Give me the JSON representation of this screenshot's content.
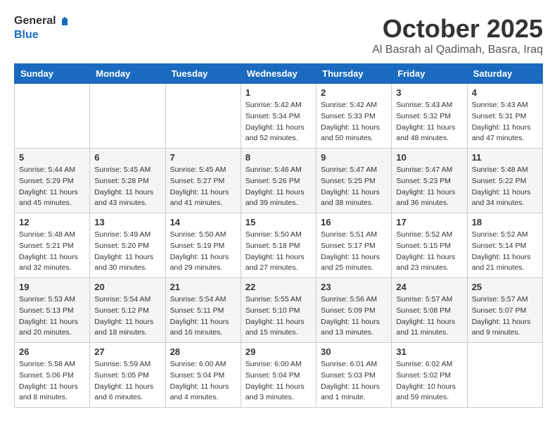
{
  "header": {
    "logo_general": "General",
    "logo_blue": "Blue",
    "month": "October 2025",
    "location": "Al Basrah al Qadimah, Basra, Iraq"
  },
  "weekdays": [
    "Sunday",
    "Monday",
    "Tuesday",
    "Wednesday",
    "Thursday",
    "Friday",
    "Saturday"
  ],
  "weeks": [
    [
      {
        "day": "",
        "sunrise": "",
        "sunset": "",
        "daylight": ""
      },
      {
        "day": "",
        "sunrise": "",
        "sunset": "",
        "daylight": ""
      },
      {
        "day": "",
        "sunrise": "",
        "sunset": "",
        "daylight": ""
      },
      {
        "day": "1",
        "sunrise": "Sunrise: 5:42 AM",
        "sunset": "Sunset: 5:34 PM",
        "daylight": "Daylight: 11 hours and 52 minutes."
      },
      {
        "day": "2",
        "sunrise": "Sunrise: 5:42 AM",
        "sunset": "Sunset: 5:33 PM",
        "daylight": "Daylight: 11 hours and 50 minutes."
      },
      {
        "day": "3",
        "sunrise": "Sunrise: 5:43 AM",
        "sunset": "Sunset: 5:32 PM",
        "daylight": "Daylight: 11 hours and 48 minutes."
      },
      {
        "day": "4",
        "sunrise": "Sunrise: 5:43 AM",
        "sunset": "Sunset: 5:31 PM",
        "daylight": "Daylight: 11 hours and 47 minutes."
      }
    ],
    [
      {
        "day": "5",
        "sunrise": "Sunrise: 5:44 AM",
        "sunset": "Sunset: 5:29 PM",
        "daylight": "Daylight: 11 hours and 45 minutes."
      },
      {
        "day": "6",
        "sunrise": "Sunrise: 5:45 AM",
        "sunset": "Sunset: 5:28 PM",
        "daylight": "Daylight: 11 hours and 43 minutes."
      },
      {
        "day": "7",
        "sunrise": "Sunrise: 5:45 AM",
        "sunset": "Sunset: 5:27 PM",
        "daylight": "Daylight: 11 hours and 41 minutes."
      },
      {
        "day": "8",
        "sunrise": "Sunrise: 5:46 AM",
        "sunset": "Sunset: 5:26 PM",
        "daylight": "Daylight: 11 hours and 39 minutes."
      },
      {
        "day": "9",
        "sunrise": "Sunrise: 5:47 AM",
        "sunset": "Sunset: 5:25 PM",
        "daylight": "Daylight: 11 hours and 38 minutes."
      },
      {
        "day": "10",
        "sunrise": "Sunrise: 5:47 AM",
        "sunset": "Sunset: 5:23 PM",
        "daylight": "Daylight: 11 hours and 36 minutes."
      },
      {
        "day": "11",
        "sunrise": "Sunrise: 5:48 AM",
        "sunset": "Sunset: 5:22 PM",
        "daylight": "Daylight: 11 hours and 34 minutes."
      }
    ],
    [
      {
        "day": "12",
        "sunrise": "Sunrise: 5:48 AM",
        "sunset": "Sunset: 5:21 PM",
        "daylight": "Daylight: 11 hours and 32 minutes."
      },
      {
        "day": "13",
        "sunrise": "Sunrise: 5:49 AM",
        "sunset": "Sunset: 5:20 PM",
        "daylight": "Daylight: 11 hours and 30 minutes."
      },
      {
        "day": "14",
        "sunrise": "Sunrise: 5:50 AM",
        "sunset": "Sunset: 5:19 PM",
        "daylight": "Daylight: 11 hours and 29 minutes."
      },
      {
        "day": "15",
        "sunrise": "Sunrise: 5:50 AM",
        "sunset": "Sunset: 5:18 PM",
        "daylight": "Daylight: 11 hours and 27 minutes."
      },
      {
        "day": "16",
        "sunrise": "Sunrise: 5:51 AM",
        "sunset": "Sunset: 5:17 PM",
        "daylight": "Daylight: 11 hours and 25 minutes."
      },
      {
        "day": "17",
        "sunrise": "Sunrise: 5:52 AM",
        "sunset": "Sunset: 5:15 PM",
        "daylight": "Daylight: 11 hours and 23 minutes."
      },
      {
        "day": "18",
        "sunrise": "Sunrise: 5:52 AM",
        "sunset": "Sunset: 5:14 PM",
        "daylight": "Daylight: 11 hours and 21 minutes."
      }
    ],
    [
      {
        "day": "19",
        "sunrise": "Sunrise: 5:53 AM",
        "sunset": "Sunset: 5:13 PM",
        "daylight": "Daylight: 11 hours and 20 minutes."
      },
      {
        "day": "20",
        "sunrise": "Sunrise: 5:54 AM",
        "sunset": "Sunset: 5:12 PM",
        "daylight": "Daylight: 11 hours and 18 minutes."
      },
      {
        "day": "21",
        "sunrise": "Sunrise: 5:54 AM",
        "sunset": "Sunset: 5:11 PM",
        "daylight": "Daylight: 11 hours and 16 minutes."
      },
      {
        "day": "22",
        "sunrise": "Sunrise: 5:55 AM",
        "sunset": "Sunset: 5:10 PM",
        "daylight": "Daylight: 11 hours and 15 minutes."
      },
      {
        "day": "23",
        "sunrise": "Sunrise: 5:56 AM",
        "sunset": "Sunset: 5:09 PM",
        "daylight": "Daylight: 11 hours and 13 minutes."
      },
      {
        "day": "24",
        "sunrise": "Sunrise: 5:57 AM",
        "sunset": "Sunset: 5:08 PM",
        "daylight": "Daylight: 11 hours and 11 minutes."
      },
      {
        "day": "25",
        "sunrise": "Sunrise: 5:57 AM",
        "sunset": "Sunset: 5:07 PM",
        "daylight": "Daylight: 11 hours and 9 minutes."
      }
    ],
    [
      {
        "day": "26",
        "sunrise": "Sunrise: 5:58 AM",
        "sunset": "Sunset: 5:06 PM",
        "daylight": "Daylight: 11 hours and 8 minutes."
      },
      {
        "day": "27",
        "sunrise": "Sunrise: 5:59 AM",
        "sunset": "Sunset: 5:05 PM",
        "daylight": "Daylight: 11 hours and 6 minutes."
      },
      {
        "day": "28",
        "sunrise": "Sunrise: 6:00 AM",
        "sunset": "Sunset: 5:04 PM",
        "daylight": "Daylight: 11 hours and 4 minutes."
      },
      {
        "day": "29",
        "sunrise": "Sunrise: 6:00 AM",
        "sunset": "Sunset: 5:04 PM",
        "daylight": "Daylight: 11 hours and 3 minutes."
      },
      {
        "day": "30",
        "sunrise": "Sunrise: 6:01 AM",
        "sunset": "Sunset: 5:03 PM",
        "daylight": "Daylight: 11 hours and 1 minute."
      },
      {
        "day": "31",
        "sunrise": "Sunrise: 6:02 AM",
        "sunset": "Sunset: 5:02 PM",
        "daylight": "Daylight: 10 hours and 59 minutes."
      },
      {
        "day": "",
        "sunrise": "",
        "sunset": "",
        "daylight": ""
      }
    ]
  ]
}
